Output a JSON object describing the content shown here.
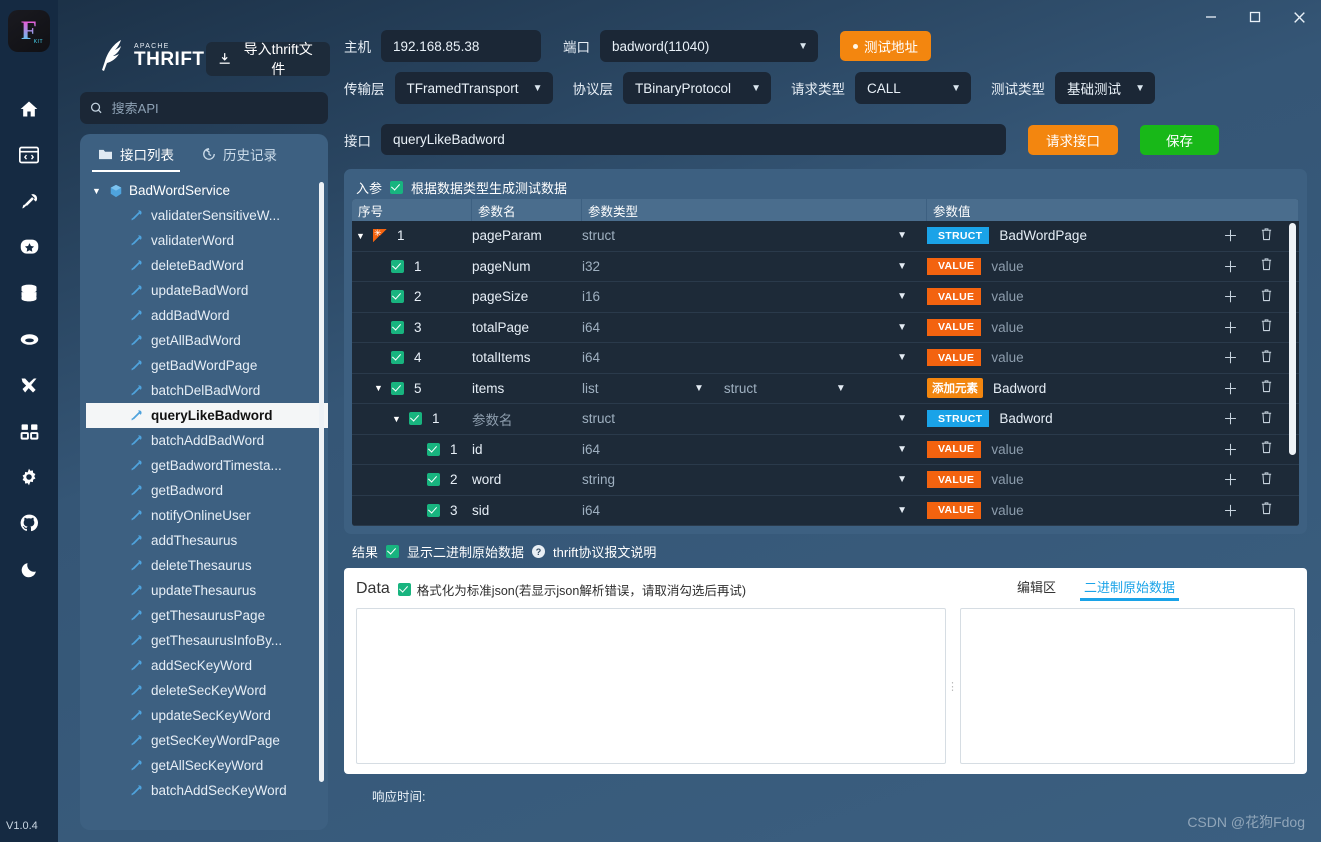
{
  "window": {
    "minimize": "—",
    "maximize": "□",
    "close": "×"
  },
  "rail": {
    "app_badge": "F",
    "app_badge_sub": "KIT",
    "version": "V1.0.4",
    "icons": [
      {
        "name": "home-icon"
      },
      {
        "name": "code-window-icon"
      },
      {
        "name": "plug-icon"
      },
      {
        "name": "star-badge-icon"
      },
      {
        "name": "database-icon"
      },
      {
        "name": "capsule-icon"
      },
      {
        "name": "tools-icon"
      },
      {
        "name": "grid-apps-icon"
      },
      {
        "name": "gear-icon"
      },
      {
        "name": "github-icon"
      },
      {
        "name": "moon-icon"
      }
    ]
  },
  "brand": {
    "apache": "APACHE",
    "thrift": "THRIFT",
    "import_button": "导入thrift文件"
  },
  "search": {
    "placeholder": "搜索API",
    "value": ""
  },
  "left_tabs": [
    {
      "label": "接口列表",
      "icon": "folder-icon",
      "active": true
    },
    {
      "label": "历史记录",
      "icon": "history-icon",
      "active": false
    }
  ],
  "tree": {
    "root": "BadWordService",
    "items": [
      "validaterSensitiveW...",
      "validaterWord",
      "deleteBadWord",
      "updateBadWord",
      "addBadWord",
      "getAllBadWord",
      "getBadWordPage",
      "batchDelBadWord",
      "queryLikeBadword",
      "batchAddBadWord",
      "getBadwordTimesta...",
      "getBadword",
      "notifyOnlineUser",
      "addThesaurus",
      "deleteThesaurus",
      "updateThesaurus",
      "getThesaurusPage",
      "getThesaurusInfoBy...",
      "addSecKeyWord",
      "deleteSecKeyWord",
      "updateSecKeyWord",
      "getSecKeyWordPage",
      "getAllSecKeyWord",
      "batchAddSecKeyWord"
    ],
    "selected": "queryLikeBadword"
  },
  "form": {
    "host_label": "主机",
    "host_value": "192.168.85.38",
    "port_label": "端口",
    "port_value": "badword(11040)",
    "test_addr_button": "测试地址",
    "transport_label": "传输层",
    "transport_value": "TFramedTransport",
    "protocol_label": "协议层",
    "protocol_value": "TBinaryProtocol",
    "reqtype_label": "请求类型",
    "reqtype_value": "CALL",
    "testtype_label": "测试类型",
    "testtype_value": "基础测试",
    "iface_label": "接口",
    "iface_value": "queryLikeBadword",
    "request_button": "请求接口",
    "save_button": "保存"
  },
  "params": {
    "title": "入参",
    "gen_checkbox_label": "根据数据类型生成测试数据",
    "gen_checked": true,
    "headers": {
      "seq": "序号",
      "name": "参数名",
      "type": "参数类型",
      "value": "参数值"
    },
    "rows": [
      {
        "indent": 0,
        "seq": "1",
        "marker": "flag",
        "expandable": true,
        "name": "pageParam",
        "type": "struct",
        "tag": "STRUCT",
        "tag_kind": "struct",
        "value": "BadWordPage",
        "name_placeholder": false
      },
      {
        "indent": 1,
        "seq": "1",
        "marker": "check",
        "expandable": false,
        "name": "pageNum",
        "type": "i32",
        "tag": "VALUE",
        "tag_kind": "value",
        "value": "value",
        "name_placeholder": false
      },
      {
        "indent": 1,
        "seq": "2",
        "marker": "check",
        "expandable": false,
        "name": "pageSize",
        "type": "i16",
        "tag": "VALUE",
        "tag_kind": "value",
        "value": "value",
        "name_placeholder": false
      },
      {
        "indent": 1,
        "seq": "3",
        "marker": "check",
        "expandable": false,
        "name": "totalPage",
        "type": "i64",
        "tag": "VALUE",
        "tag_kind": "value",
        "value": "value",
        "name_placeholder": false
      },
      {
        "indent": 1,
        "seq": "4",
        "marker": "check",
        "expandable": false,
        "name": "totalItems",
        "type": "i64",
        "tag": "VALUE",
        "tag_kind": "value",
        "value": "value",
        "name_placeholder": false
      },
      {
        "indent": 1,
        "seq": "5",
        "marker": "check",
        "expandable": true,
        "name": "items",
        "type": "list",
        "type2": "struct",
        "tag": "添加元素",
        "tag_kind": "add",
        "value": "Badword",
        "name_placeholder": false
      },
      {
        "indent": 2,
        "seq": "1",
        "marker": "check",
        "expandable": true,
        "name": "参数名",
        "type": "struct",
        "tag": "STRUCT",
        "tag_kind": "struct",
        "value": "Badword",
        "name_placeholder": true
      },
      {
        "indent": 3,
        "seq": "1",
        "marker": "check",
        "expandable": false,
        "name": "id",
        "type": "i64",
        "tag": "VALUE",
        "tag_kind": "value",
        "value": "value",
        "name_placeholder": false
      },
      {
        "indent": 3,
        "seq": "2",
        "marker": "check",
        "expandable": false,
        "name": "word",
        "type": "string",
        "tag": "VALUE",
        "tag_kind": "value",
        "value": "value",
        "name_placeholder": false
      },
      {
        "indent": 3,
        "seq": "3",
        "marker": "check",
        "expandable": false,
        "name": "sid",
        "type": "i64",
        "tag": "VALUE",
        "tag_kind": "value",
        "value": "value",
        "name_placeholder": false
      }
    ],
    "row_add_icon": "plus-icon",
    "row_delete_icon": "trash-icon"
  },
  "result": {
    "title": "结果",
    "show_binary_label": "显示二进制原始数据",
    "show_binary_checked": true,
    "help_icon": "question-icon",
    "help_link": "thrift协议报文说明"
  },
  "data_panel": {
    "title": "Data",
    "format_checked": true,
    "format_label": "格式化为标准json(若显示json解析错误，请取消勾选后再试)",
    "tabs": [
      {
        "label": "编辑区",
        "active": false
      },
      {
        "label": "二进制原始数据",
        "active": true
      }
    ],
    "editor_value": "",
    "binary_value": ""
  },
  "footer": {
    "response_time_label": "响应时间:",
    "watermark": "CSDN @花狗Fdog"
  },
  "colors": {
    "accent_orange": "#f3860f",
    "accent_green": "#18b818",
    "accent_blue": "#1aa3e8",
    "panel_blue": "#3d6081",
    "table_bg": "#1d2a38",
    "check_green": "#18b47f"
  }
}
